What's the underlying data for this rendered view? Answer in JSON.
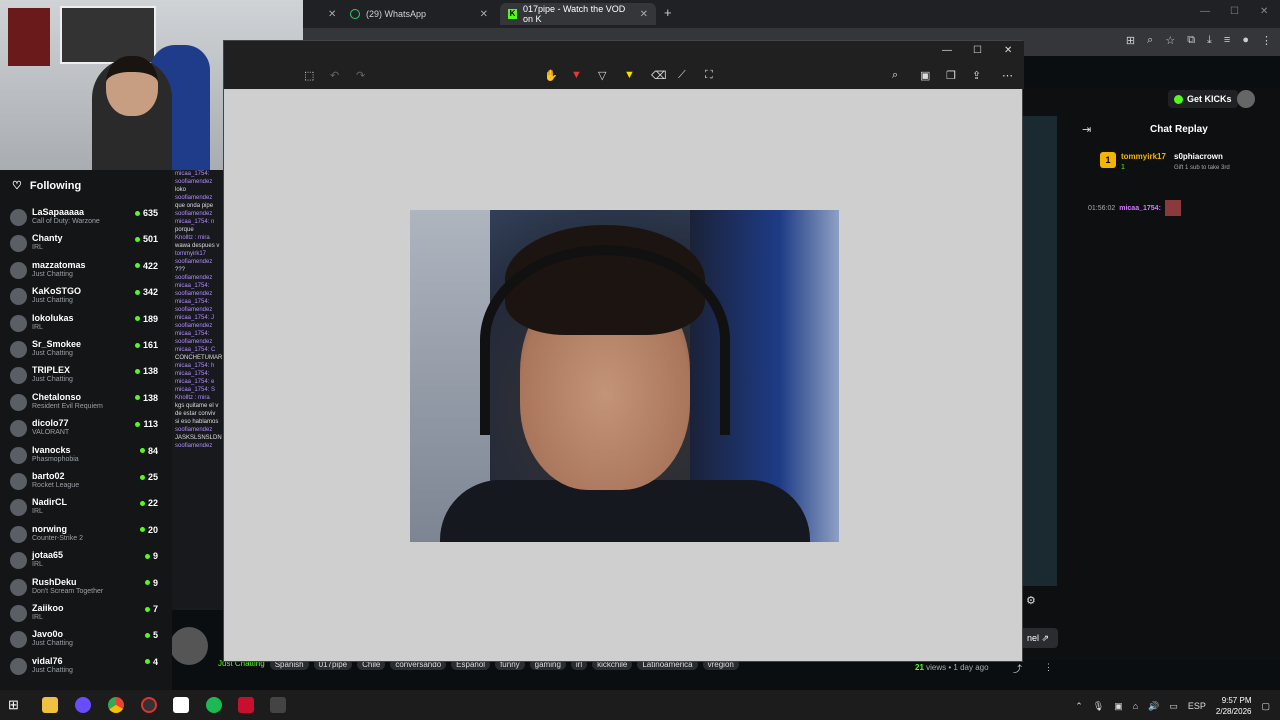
{
  "browser": {
    "tabs": [
      {
        "label": "(29) WhatsApp",
        "icon": "whatsapp-icon"
      },
      {
        "label": "017pipe - Watch the VOD on K",
        "icon": "kick-icon"
      }
    ]
  },
  "sidebar": {
    "header": "Following",
    "channels": [
      {
        "name": "LaSapaaaaa",
        "category": "Call of Duty: Warzone",
        "viewers": "635"
      },
      {
        "name": "Chanty",
        "category": "IRL",
        "viewers": "501"
      },
      {
        "name": "mazzatomas",
        "category": "Just Chatting",
        "viewers": "422"
      },
      {
        "name": "KaKoSTGO",
        "category": "Just Chatting",
        "viewers": "342"
      },
      {
        "name": "lokolukas",
        "category": "IRL",
        "viewers": "189"
      },
      {
        "name": "Sr_Smokee",
        "category": "Just Chatting",
        "viewers": "161"
      },
      {
        "name": "TRIPLEX",
        "category": "Just Chatting",
        "viewers": "138"
      },
      {
        "name": "Chetalonso",
        "category": "Resident Evil Requiem",
        "viewers": "138"
      },
      {
        "name": "dicolo77",
        "category": "VALORANT",
        "viewers": "113"
      },
      {
        "name": "Ivanocks",
        "category": "Phasmophobia",
        "viewers": "84"
      },
      {
        "name": "barto02",
        "category": "Rocket League",
        "viewers": "25"
      },
      {
        "name": "NadirCL",
        "category": "IRL",
        "viewers": "22"
      },
      {
        "name": "norwing",
        "category": "Counter-Strike 2",
        "viewers": "20"
      },
      {
        "name": "jotaa65",
        "category": "IRL",
        "viewers": "9"
      },
      {
        "name": "RushDeku",
        "category": "Don't Scream Together",
        "viewers": "9"
      },
      {
        "name": "Zaiikoo",
        "category": "IRL",
        "viewers": "7"
      },
      {
        "name": "Javo0o",
        "category": "Just Chatting",
        "viewers": "5"
      },
      {
        "name": "vidal76",
        "category": "Just Chatting",
        "viewers": "4"
      }
    ]
  },
  "side_chat": [
    {
      "text": "micaa_1754: ",
      "w": false
    },
    {
      "text": "soofiamendez",
      "w": false
    },
    {
      "text": "loko",
      "w": true
    },
    {
      "text": "soofiamendez",
      "w": false
    },
    {
      "text": "que onda pipe",
      "w": true
    },
    {
      "text": "soofiamendez",
      "w": false
    },
    {
      "text": "micaa_1754: n",
      "w": false
    },
    {
      "text": "porque",
      "w": true
    },
    {
      "text": "Knolltz : mira",
      "w": false
    },
    {
      "text": "wawa despues v",
      "w": true
    },
    {
      "text": "tommyirk17",
      "w": false
    },
    {
      "text": "soofiamendez",
      "w": false
    },
    {
      "text": "???",
      "w": true
    },
    {
      "text": "soofiamendez",
      "w": false
    },
    {
      "text": "micaa_1754: ",
      "w": false
    },
    {
      "text": "soofiamendez",
      "w": false
    },
    {
      "text": "micaa_1754: ",
      "w": false
    },
    {
      "text": "soofiamendez",
      "w": false
    },
    {
      "text": "micaa_1754: J",
      "w": false
    },
    {
      "text": "soofiamendez",
      "w": false
    },
    {
      "text": "micaa_1754: ",
      "w": false
    },
    {
      "text": "soofiamendez",
      "w": false
    },
    {
      "text": "micaa_1754: C",
      "w": false
    },
    {
      "text": "CONCHETUMAR",
      "w": true
    },
    {
      "text": "micaa_1754: h",
      "w": false
    },
    {
      "text": "micaa_1754: ",
      "w": false
    },
    {
      "text": "micaa_1754: e",
      "w": false
    },
    {
      "text": "micaa_1754: S",
      "w": false
    },
    {
      "text": "Knolltz : mira",
      "w": false
    },
    {
      "text": "kgs quitame el v",
      "w": true
    },
    {
      "text": "de estar conviv",
      "w": true
    },
    {
      "text": "si eso hablamos",
      "w": true
    },
    {
      "text": "soofiamendez",
      "w": false
    },
    {
      "text": "JASKSLSNSLDN",
      "w": true
    },
    {
      "text": "soofiamendez",
      "w": false
    }
  ],
  "snipping_tool": {
    "tools": [
      "touch-write-icon",
      "ballpoint-pen-icon",
      "pencil-icon",
      "highlighter-icon",
      "eraser-icon",
      "ruler-icon",
      "crop-icon"
    ],
    "right_tools": [
      "zoom-icon",
      "save-icon",
      "copy-icon",
      "share-icon",
      "more-icon"
    ]
  },
  "kick": {
    "get_kicks": "Get KICKs",
    "chat_title": "Chat Replay",
    "pinned": {
      "rank": "1",
      "user1": "tommyirk17",
      "user1_count": "1",
      "user2": "s0phiacrown",
      "user2_count": "1",
      "gift_text": "Gift 1 sub to take 3rd"
    },
    "message": {
      "time": "01:56:02",
      "user": "micaa_1754:"
    },
    "channel_btn": "nel",
    "category": "Just Chatting",
    "tags": [
      "Spanish",
      "017pipe",
      "Chile",
      "conversando",
      "Espanol",
      "funny",
      "gaming",
      "irl",
      "kickchile",
      "Latinoamerica",
      "vregion"
    ],
    "views_count": "21",
    "views_label": "views",
    "age": "1 day ago"
  },
  "taskbar": {
    "lang": "ESP",
    "time": "9:57 PM",
    "date": "2/28/2026"
  }
}
